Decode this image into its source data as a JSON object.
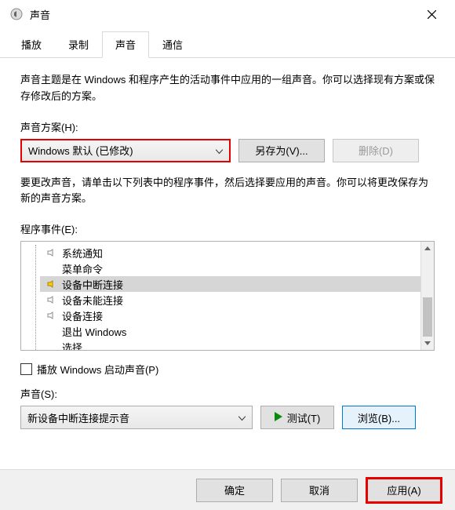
{
  "window": {
    "title": "声音"
  },
  "tabs": {
    "t0": "播放",
    "t1": "录制",
    "t2": "声音",
    "t3": "通信"
  },
  "desc1": "声音主题是在 Windows 和程序产生的活动事件中应用的一组声音。你可以选择现有方案或保存修改后的方案。",
  "schemeLabel": "声音方案(H):",
  "schemeValue": "Windows 默认 (已修改)",
  "saveAs": "另存为(V)...",
  "delete": "删除(D)",
  "desc2": "要更改声音，请单击以下列表中的程序事件，然后选择要应用的声音。你可以将更改保存为新的声音方案。",
  "eventsLabel": "程序事件(E):",
  "events": {
    "e0": "系统通知",
    "e1": "菜单命令",
    "e2": "设备中断连接",
    "e3": "设备未能连接",
    "e4": "设备连接",
    "e5": "退出 Windows",
    "e6": "选择"
  },
  "playStartup": "播放 Windows 启动声音(P)",
  "soundLabel": "声音(S):",
  "soundValue": "新设备中断连接提示音",
  "test": "测试(T)",
  "browse": "浏览(B)...",
  "ok": "确定",
  "cancel": "取消",
  "apply": "应用(A)"
}
